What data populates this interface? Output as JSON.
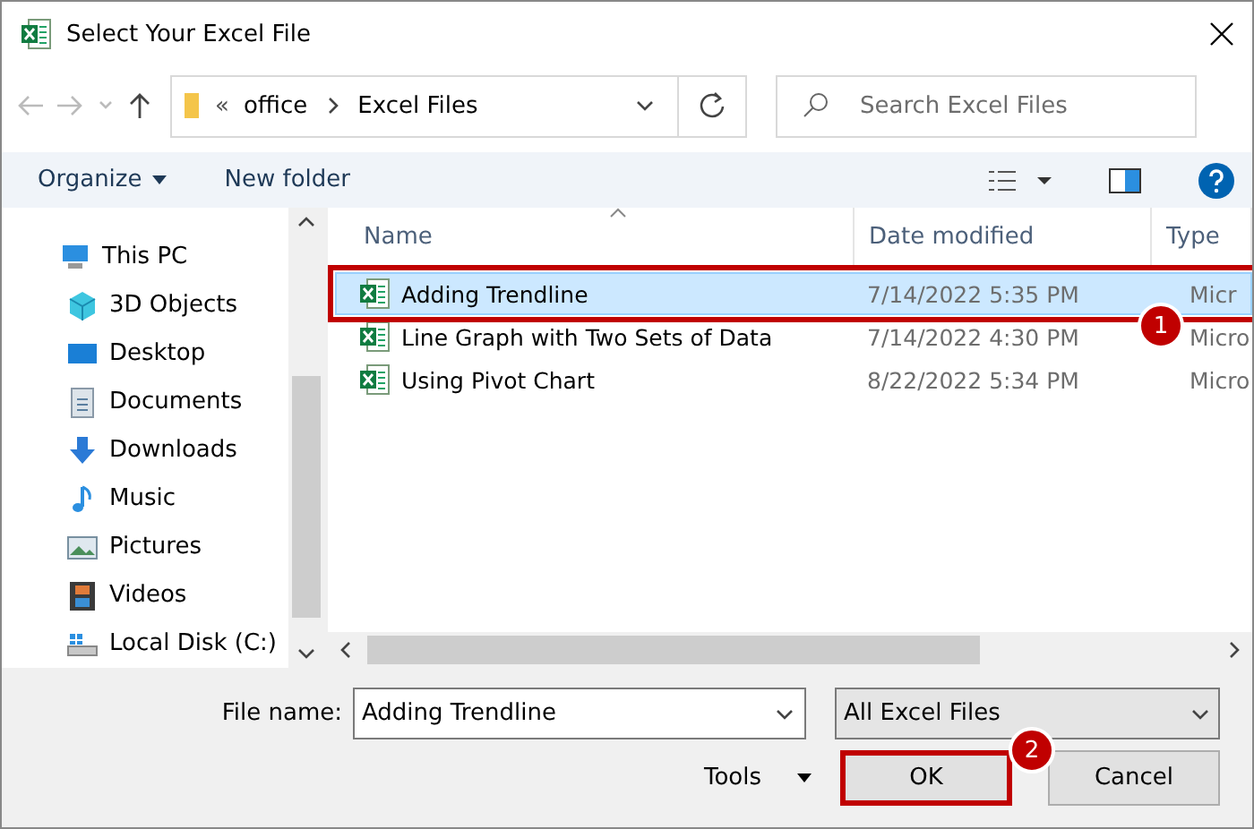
{
  "window": {
    "title": "Select Your Excel File"
  },
  "address": {
    "path": [
      {
        "label": "office"
      },
      {
        "label": "Excel Files"
      }
    ],
    "overflow": "«"
  },
  "search": {
    "placeholder": "Search Excel Files"
  },
  "toolbar": {
    "organize": "Organize",
    "new_folder": "New folder"
  },
  "sidebar": {
    "items": [
      {
        "label": "This PC"
      },
      {
        "label": "3D Objects"
      },
      {
        "label": "Desktop"
      },
      {
        "label": "Documents"
      },
      {
        "label": "Downloads"
      },
      {
        "label": "Music"
      },
      {
        "label": "Pictures"
      },
      {
        "label": "Videos"
      },
      {
        "label": "Local Disk (C:)"
      }
    ]
  },
  "table": {
    "columns": [
      "Name",
      "Date modified",
      "Type"
    ],
    "rows": [
      {
        "name": "Adding Trendline",
        "date": "7/14/2022 5:35 PM",
        "type": "Micr",
        "selected": true,
        "outlined": true
      },
      {
        "name": "Line Graph with Two Sets of Data",
        "date": "7/14/2022 4:30 PM",
        "type": "Micro",
        "selected": false,
        "outlined": false
      },
      {
        "name": "Using Pivot Chart",
        "date": "8/22/2022 5:34 PM",
        "type": "Micro",
        "selected": false,
        "outlined": false
      }
    ]
  },
  "footer": {
    "file_name_label": "File name:",
    "file_name": "Adding Trendline",
    "filter": "All Excel Files",
    "tools": "Tools",
    "buttons": [
      {
        "label": "OK",
        "kind": "primary",
        "outlined": true
      },
      {
        "label": "Cancel",
        "kind": "normal",
        "outlined": false
      }
    ]
  },
  "callouts": [
    {
      "number": "1"
    },
    {
      "number": "2"
    }
  ]
}
